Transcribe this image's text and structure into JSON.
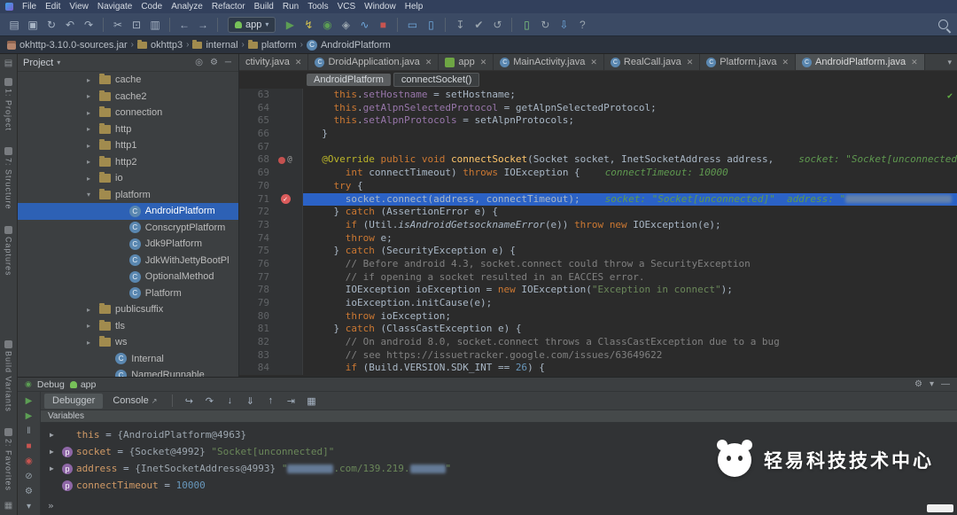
{
  "colors": {
    "menubar_bg": "#32405c",
    "toolbar_bg": "#3b4a64",
    "navbar_bg": "#2b323d",
    "panel_bg": "#3c3f41",
    "editor_bg": "#2b2b2b",
    "gutter_bg": "#313335",
    "selection_bg": "#2d61b5",
    "exec_line_bg": "#2b62c6",
    "tab_active_bg": "#4e5254",
    "keyword": "#cc7832",
    "field": "#9876aa",
    "string": "#6a8759",
    "comment": "#808080",
    "number": "#6897bb",
    "method": "#ffc66b",
    "annotation": "#bbb529",
    "hint": "#5f9950",
    "code_text": "#a9b7c6",
    "breakpoint_red": "#db5c5c",
    "run_green": "#5c9e54",
    "stop_red": "#c75450",
    "var_name": "#d19a66",
    "var_object": "#9da7b0"
  },
  "menubar": {
    "items": [
      "File",
      "Edit",
      "View",
      "Navigate",
      "Code",
      "Analyze",
      "Refactor",
      "Build",
      "Run",
      "Tools",
      "VCS",
      "Window",
      "Help"
    ]
  },
  "toolbar": {
    "run_config": "app",
    "items": [
      {
        "name": "open-icon",
        "g": "▤"
      },
      {
        "name": "save-all-icon",
        "g": "▣"
      },
      {
        "name": "sync-icon",
        "g": "↻"
      },
      {
        "name": "undo-icon",
        "g": "↶"
      },
      {
        "name": "redo-icon",
        "g": "↷"
      },
      {
        "sep": true
      },
      {
        "name": "cut-icon",
        "g": "✂"
      },
      {
        "name": "copy-icon",
        "g": "⊡"
      },
      {
        "name": "paste-icon",
        "g": "▥"
      },
      {
        "sep": true
      },
      {
        "name": "back-icon",
        "g": "←"
      },
      {
        "name": "forward-icon",
        "g": "→"
      },
      {
        "sep": true
      },
      {
        "config": true
      },
      {
        "name": "run-button",
        "g": "▶",
        "c": "#5c9e54"
      },
      {
        "name": "apply-changes-icon",
        "g": "↯",
        "c": "#d4c14f"
      },
      {
        "name": "debug-button",
        "g": "◉",
        "c": "#5c9e54"
      },
      {
        "name": "coverage-button",
        "g": "◈",
        "c": "#9aa5ae"
      },
      {
        "name": "profiler-button",
        "g": "∿",
        "c": "#6fa8dc"
      },
      {
        "name": "stop-button",
        "g": "■",
        "c": "#c75450"
      },
      {
        "sep": true
      },
      {
        "name": "device-monitor-icon",
        "g": "▭",
        "c": "#6fa8dc"
      },
      {
        "name": "layout-inspector-icon",
        "g": "▯",
        "c": "#6fa8dc"
      },
      {
        "sep": true
      },
      {
        "name": "vcs-update-icon",
        "g": "↧",
        "c": "#9aa5ae"
      },
      {
        "name": "vcs-commit-icon",
        "g": "✔",
        "c": "#9aa5ae"
      },
      {
        "name": "vcs-revert-icon",
        "g": "↺",
        "c": "#9aa5ae"
      },
      {
        "sep": true
      },
      {
        "name": "avd-manager-icon",
        "g": "▯",
        "c": "#7ec47e"
      },
      {
        "name": "gradle-sync-icon",
        "g": "↻",
        "c": "#9aa5ae"
      },
      {
        "name": "sdk-manager-icon",
        "g": "⇩",
        "c": "#6fa8dc"
      },
      {
        "name": "help-icon",
        "g": "?",
        "c": "#9aa5ae"
      }
    ]
  },
  "navbar": {
    "crumbs": [
      {
        "label": "okhttp-3.10.0-sources.jar",
        "icon": "jar"
      },
      {
        "label": "okhttp3",
        "icon": "package"
      },
      {
        "label": "internal",
        "icon": "package"
      },
      {
        "label": "platform",
        "icon": "package"
      },
      {
        "label": "AndroidPlatform",
        "icon": "class"
      }
    ]
  },
  "stripe": {
    "top": [
      "1: Project",
      "7: Structure",
      "Captures"
    ],
    "bottom": [
      "Build Variants",
      "2: Favorites"
    ]
  },
  "project": {
    "header": "Project",
    "items": [
      {
        "label": "cache",
        "type": "folder",
        "arrow": "c",
        "d": 0
      },
      {
        "label": "cache2",
        "type": "folder",
        "arrow": "c",
        "d": 0
      },
      {
        "label": "connection",
        "type": "folder",
        "arrow": "c",
        "d": 0
      },
      {
        "label": "http",
        "type": "folder",
        "arrow": "c",
        "d": 0
      },
      {
        "label": "http1",
        "type": "folder",
        "arrow": "c",
        "d": 0
      },
      {
        "label": "http2",
        "type": "folder",
        "arrow": "c",
        "d": 0
      },
      {
        "label": "io",
        "type": "folder",
        "arrow": "c",
        "d": 0
      },
      {
        "label": "platform",
        "type": "folder",
        "arrow": "o",
        "d": 0
      },
      {
        "label": "AndroidPlatform",
        "type": "class",
        "d": 1.3,
        "selected": true
      },
      {
        "label": "ConscryptPlatform",
        "type": "class",
        "d": 1.3
      },
      {
        "label": "Jdk9Platform",
        "type": "class",
        "d": 1.3
      },
      {
        "label": "JdkWithJettyBootPl",
        "type": "class",
        "d": 1.3
      },
      {
        "label": "OptionalMethod",
        "type": "class",
        "d": 1.3
      },
      {
        "label": "Platform",
        "type": "class",
        "d": 1.3
      },
      {
        "label": "publicsuffix",
        "type": "folder",
        "arrow": "c",
        "d": 0
      },
      {
        "label": "tls",
        "type": "folder",
        "arrow": "c",
        "d": 0
      },
      {
        "label": "ws",
        "type": "folder",
        "arrow": "c",
        "d": 0
      },
      {
        "label": "Internal",
        "type": "class",
        "d": 0.7
      },
      {
        "label": "NamedRunnable",
        "type": "class",
        "d": 0.7
      }
    ]
  },
  "editor": {
    "tabs": [
      {
        "label": "ctivity.java",
        "icon": "class",
        "clipped": true
      },
      {
        "label": "DroidApplication.java",
        "icon": "class"
      },
      {
        "label": "app",
        "icon": "module"
      },
      {
        "label": "MainActivity.java",
        "icon": "class"
      },
      {
        "label": "RealCall.java",
        "icon": "class"
      },
      {
        "label": "Platform.java",
        "icon": "class"
      },
      {
        "label": "AndroidPlatform.java",
        "icon": "class",
        "active": true
      }
    ],
    "breadcrumbs": [
      "AndroidPlatform",
      "connectSocket()"
    ],
    "lines": [
      {
        "n": 63,
        "t": [
          [
            "d",
            "    "
          ],
          [
            "k",
            "this"
          ],
          [
            "d",
            "."
          ],
          [
            "f",
            "setHostname"
          ],
          [
            "d",
            " = setHostname;"
          ]
        ]
      },
      {
        "n": 64,
        "t": [
          [
            "d",
            "    "
          ],
          [
            "k",
            "this"
          ],
          [
            "d",
            "."
          ],
          [
            "f",
            "getAlpnSelectedProtocol"
          ],
          [
            "d",
            " = getAlpnSelectedProtocol;"
          ]
        ]
      },
      {
        "n": 65,
        "t": [
          [
            "d",
            "    "
          ],
          [
            "k",
            "this"
          ],
          [
            "d",
            "."
          ],
          [
            "f",
            "setAlpnProtocols"
          ],
          [
            "d",
            " = setAlpnProtocols;"
          ]
        ]
      },
      {
        "n": 66,
        "t": [
          [
            "d",
            "  }"
          ]
        ]
      },
      {
        "n": 67,
        "t": []
      },
      {
        "n": 68,
        "gi": true,
        "t": [
          [
            "d",
            "  "
          ],
          [
            "a",
            "@Override"
          ],
          [
            "d",
            " "
          ],
          [
            "k",
            "public"
          ],
          [
            "d",
            " "
          ],
          [
            "k",
            "void"
          ],
          [
            "d",
            " "
          ],
          [
            "m",
            "connectSocket"
          ],
          [
            "d",
            "(Socket socket, InetSocketAddress address,"
          ]
        ],
        "h": [
          [
            "h",
            "socket: \"Socket[unconnected]\""
          ]
        ]
      },
      {
        "n": 69,
        "t": [
          [
            "d",
            "      "
          ],
          [
            "k",
            "int"
          ],
          [
            "d",
            " connectTimeout) "
          ],
          [
            "k",
            "throws"
          ],
          [
            "d",
            " IOException {"
          ]
        ],
        "h": [
          [
            "h",
            "connectTimeout: 10000"
          ]
        ]
      },
      {
        "n": 70,
        "t": [
          [
            "d",
            "    "
          ],
          [
            "k",
            "try"
          ],
          [
            "d",
            " {"
          ]
        ]
      },
      {
        "n": 71,
        "bp": true,
        "exec": true,
        "t": [
          [
            "d",
            "      socket.connect(address, connectTimeout);"
          ]
        ],
        "h": [
          [
            "h",
            "socket: \"Socket[unconnected]\"  address: \""
          ],
          [
            "r",
            "120"
          ]
        ]
      },
      {
        "n": 72,
        "t": [
          [
            "d",
            "    } "
          ],
          [
            "k",
            "catch"
          ],
          [
            "d",
            " (AssertionError e) {"
          ]
        ]
      },
      {
        "n": 73,
        "t": [
          [
            "d",
            "      "
          ],
          [
            "k",
            "if"
          ],
          [
            "d",
            " (Util."
          ],
          [
            "i",
            "isAndroidGetsocknameError"
          ],
          [
            "d",
            "(e)) "
          ],
          [
            "k",
            "throw"
          ],
          [
            "d",
            " "
          ],
          [
            "k",
            "new"
          ],
          [
            "d",
            " IOException(e);"
          ]
        ]
      },
      {
        "n": 74,
        "t": [
          [
            "d",
            "      "
          ],
          [
            "k",
            "throw"
          ],
          [
            "d",
            " e;"
          ]
        ]
      },
      {
        "n": 75,
        "t": [
          [
            "d",
            "    } "
          ],
          [
            "k",
            "catch"
          ],
          [
            "d",
            " (SecurityException e) {"
          ]
        ]
      },
      {
        "n": 76,
        "t": [
          [
            "c",
            "      // Before android 4.3, socket.connect could throw a SecurityException"
          ]
        ]
      },
      {
        "n": 77,
        "t": [
          [
            "c",
            "      // if opening a socket resulted in an EACCES error."
          ]
        ]
      },
      {
        "n": 78,
        "t": [
          [
            "d",
            "      IOException ioException = "
          ],
          [
            "k",
            "new"
          ],
          [
            "d",
            " IOException("
          ],
          [
            "s",
            "\"Exception in connect\""
          ],
          [
            "d",
            ");"
          ]
        ]
      },
      {
        "n": 79,
        "t": [
          [
            "d",
            "      ioException.initCause(e);"
          ]
        ]
      },
      {
        "n": 80,
        "t": [
          [
            "d",
            "      "
          ],
          [
            "k",
            "throw"
          ],
          [
            "d",
            " ioException;"
          ]
        ]
      },
      {
        "n": 81,
        "t": [
          [
            "d",
            "    } "
          ],
          [
            "k",
            "catch"
          ],
          [
            "d",
            " (ClassCastException e) {"
          ]
        ]
      },
      {
        "n": 82,
        "t": [
          [
            "c",
            "      // On android 8.0, socket.connect throws a ClassCastException due to a bug"
          ]
        ]
      },
      {
        "n": 83,
        "t": [
          [
            "c",
            "      // see https://issuetracker.google.com/issues/63649622"
          ]
        ]
      },
      {
        "n": 84,
        "t": [
          [
            "d",
            "      "
          ],
          [
            "k",
            "if"
          ],
          [
            "d",
            " (Build.VERSION.SDK_INT == "
          ],
          [
            "n",
            "26"
          ],
          [
            "d",
            ") {"
          ]
        ]
      }
    ]
  },
  "debug": {
    "title": "Debug",
    "session": "app",
    "tabs": [
      {
        "label": "Debugger",
        "active": true
      },
      {
        "label": "Console",
        "active": false
      }
    ],
    "step_icons": [
      {
        "name": "show-execution-point-icon",
        "g": "↪"
      },
      {
        "name": "step-over-icon",
        "g": "↷"
      },
      {
        "name": "step-into-icon",
        "g": "↓"
      },
      {
        "name": "force-step-into-icon",
        "g": "⇓"
      },
      {
        "name": "step-out-icon",
        "g": "↑"
      },
      {
        "name": "run-to-cursor-icon",
        "g": "⇥"
      },
      {
        "name": "evaluate-expression-icon",
        "g": "▦"
      }
    ],
    "side_icons": [
      {
        "name": "rerun-button",
        "g": "▶",
        "c": "#5c9e54"
      },
      {
        "name": "resume-button",
        "g": "▶",
        "c": "#5c9e54"
      },
      {
        "name": "pause-button",
        "g": "‖",
        "c": "#9aa5ae"
      },
      {
        "name": "stop-debug-button",
        "g": "■",
        "c": "#c75450"
      },
      {
        "name": "view-breakpoints-icon",
        "g": "◉",
        "c": "#c75450"
      },
      {
        "name": "mute-breakpoints-icon",
        "g": "⊘",
        "c": "#9aa5ae"
      },
      {
        "name": "debug-settings-icon",
        "g": "⚙",
        "c": "#9aa5ae"
      },
      {
        "name": "pin-tab-icon",
        "g": "▾",
        "c": "#9aa5ae"
      }
    ],
    "header_icons": [
      {
        "name": "debug-gear-icon",
        "g": "⚙"
      },
      {
        "name": "debug-layout-chevron-icon",
        "g": "▾"
      },
      {
        "name": "hide-debug-panel-icon",
        "g": "—"
      }
    ],
    "variables_header": "Variables",
    "variables": [
      {
        "arrow": true,
        "parts": [
          [
            "nm",
            "this"
          ],
          [
            "eq",
            " = "
          ],
          [
            "obj",
            "{AndroidPlatform@4963}"
          ]
        ]
      },
      {
        "arrow": true,
        "icon": "p",
        "parts": [
          [
            "nm",
            "socket"
          ],
          [
            "eq",
            " = "
          ],
          [
            "obj",
            "{Socket@4992} "
          ],
          [
            "str",
            "\"Socket[unconnected]\""
          ]
        ]
      },
      {
        "arrow": true,
        "icon": "p",
        "parts": [
          [
            "nm",
            "address"
          ],
          [
            "eq",
            " = "
          ],
          [
            "obj",
            "{InetSocketAddress@4993} "
          ],
          [
            "str",
            "\""
          ],
          [
            "red",
            "52"
          ],
          [
            "str",
            ".com/139.219."
          ],
          [
            "red",
            "40"
          ],
          [
            "str",
            "\""
          ]
        ]
      },
      {
        "icon": "p",
        "parts": [
          [
            "nm",
            "connectTimeout"
          ],
          [
            "eq",
            " = "
          ],
          [
            "num",
            "10000"
          ]
        ]
      }
    ]
  },
  "watermark": {
    "text": "轻易科技技术中心"
  }
}
